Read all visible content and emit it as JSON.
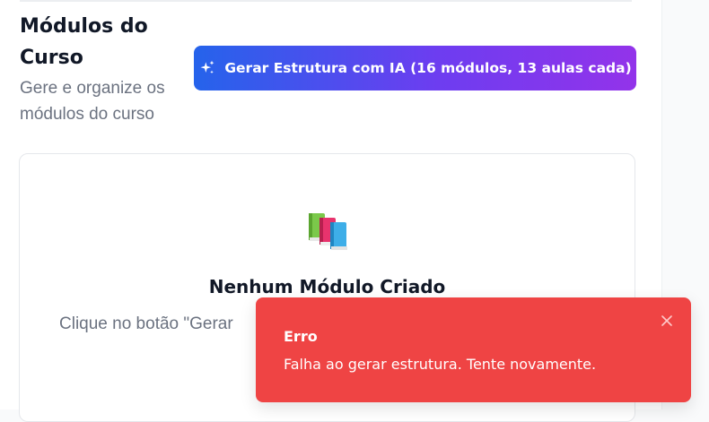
{
  "header": {
    "title": "Módulos do Curso",
    "subtitle": "Gere e organize os módulos do curso"
  },
  "generate_button": {
    "label": "Gerar Estrutura com IA (16 módulos, 13 aulas cada)",
    "icon": "sparkles-icon"
  },
  "empty_state": {
    "icon": "books-icon",
    "title": "Nenhum Módulo Criado",
    "text": "Clique no botão \"Gerar"
  },
  "toast": {
    "title": "Erro",
    "message": "Falha ao gerar estrutura. Tente novamente.",
    "close_icon": "close-icon"
  },
  "colors": {
    "primary_gradient_start": "#2563eb",
    "primary_gradient_end": "#9333ea",
    "error": "#ef4444",
    "heading": "#111827",
    "muted": "#6b7280"
  }
}
